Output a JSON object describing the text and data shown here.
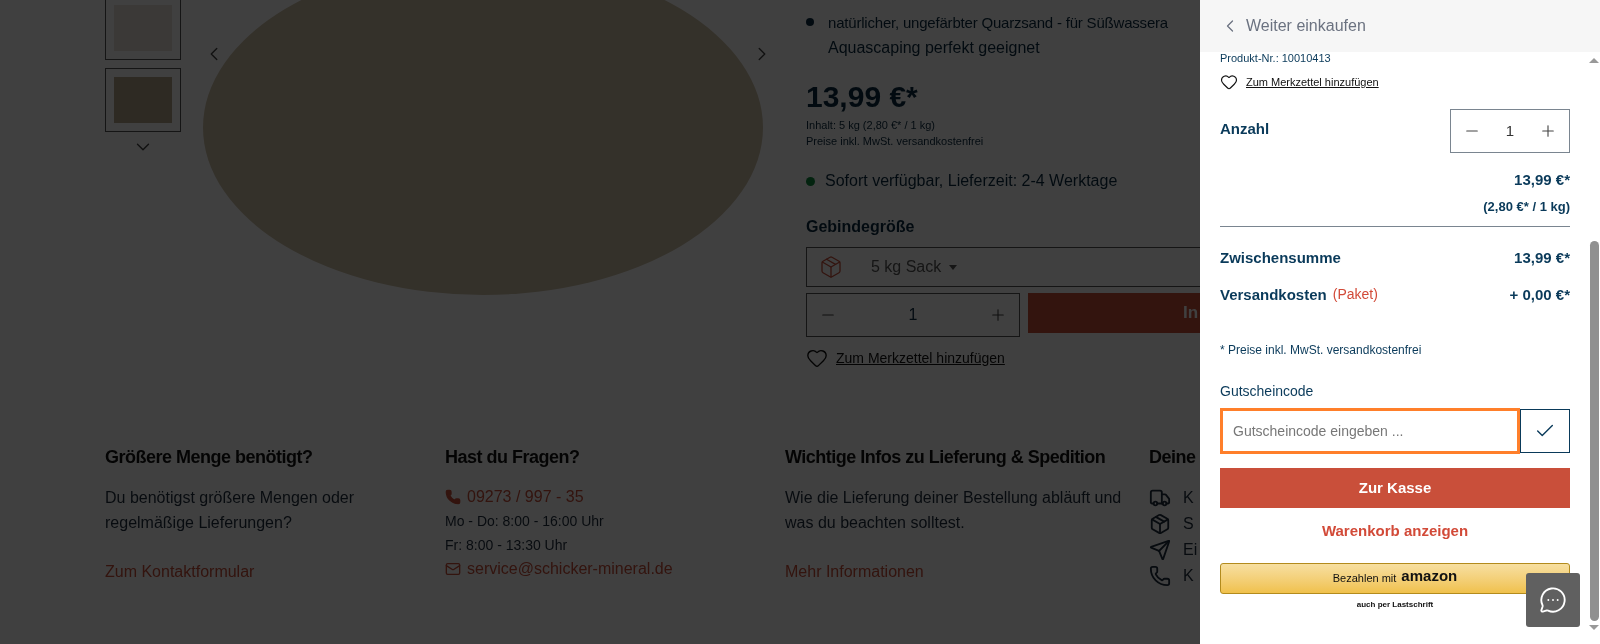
{
  "product": {
    "bullet": "natürlicher, ungefärbter Quarzsand - für Süßwassera",
    "bullet_line2": "Aquascaping perfekt geeignet",
    "price": "13,99 €*",
    "content": "Inhalt: 5 kg (2,80 €* / 1 kg)",
    "tax_note": "Preise inkl. MwSt. versandkostenfrei",
    "availability": "Sofort verfügbar, Lieferzeit: 2-4 Werktage",
    "variant_label": "Gebindegröße",
    "variant_value": "5 kg Sack",
    "quantity": "1",
    "cart_button": "In",
    "wishlist": "Zum Merkzettel hinzufügen"
  },
  "footer": {
    "columns": [
      {
        "heading": "Größere Menge benötigt?",
        "lines": [
          {
            "kind": "text",
            "text": "Du benötigst größere Mengen oder regelmäßige Lieferungen?"
          },
          {
            "kind": "link",
            "text": "Zum Kontaktformular"
          }
        ]
      },
      {
        "heading": "Hast du Fragen?",
        "lines": [
          {
            "kind": "phone",
            "text": "09273 / 997 - 35"
          },
          {
            "kind": "small",
            "text": "Mo - Do: 8:00 - 16:00 Uhr"
          },
          {
            "kind": "small",
            "text": "Fr: 8:00 - 13:30 Uhr"
          },
          {
            "kind": "email",
            "text": "service@schicker-mineral.de"
          }
        ]
      },
      {
        "heading": "Wichtige Infos zu Lieferung & Spedition",
        "lines": [
          {
            "kind": "text",
            "text": "Wie die Lieferung deiner Bestellung abläuft und was du beachten solltest."
          },
          {
            "kind": "link",
            "text": "Mehr Informationen"
          }
        ]
      },
      {
        "heading": "Deine",
        "lines": [
          {
            "kind": "truck",
            "text": "K"
          },
          {
            "kind": "box",
            "text": "S"
          },
          {
            "kind": "send",
            "text": "Ei"
          },
          {
            "kind": "call",
            "text": "K"
          }
        ]
      }
    ]
  },
  "cart_drawer": {
    "back": "Weiter einkaufen",
    "product_no": "Produkt-Nr.: 10010413",
    "wishlist": "Zum Merkzettel hinzufügen",
    "quantity_label": "Anzahl",
    "quantity": "1",
    "price": "13,99 €*",
    "unit_price": "(2,80 €* / 1 kg)",
    "subtotal": {
      "label": "Zwischensumme",
      "value": "13,99 €*"
    },
    "shipping": {
      "label": "Versandkosten",
      "note": "(Paket)",
      "value": "+ 0,00 €*"
    },
    "tax_note": "* Preise inkl. MwSt. versandkostenfrei",
    "coupon": {
      "label": "Gutscheincode",
      "placeholder": "Gutscheincode eingeben ...",
      "focused": true
    },
    "checkout": "Zur Kasse",
    "view_cart": "Warenkorb anzeigen",
    "amazon": {
      "text": "Bezahlen mit",
      "logo": "amazon",
      "note": "auch per Lastschrift"
    }
  }
}
